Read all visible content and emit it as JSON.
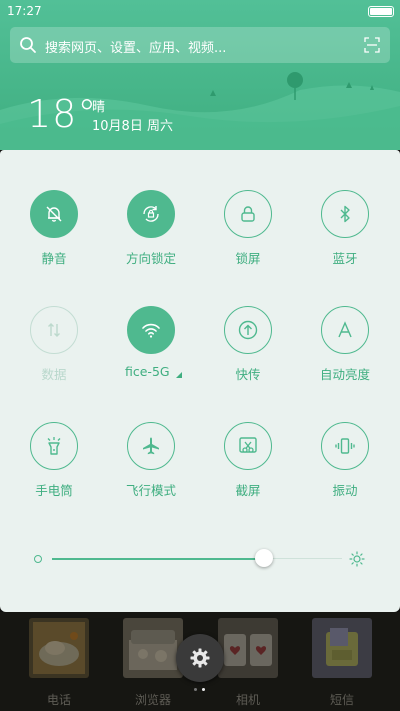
{
  "status_bar": {
    "time": "17:27"
  },
  "search": {
    "placeholder": "搜索网页、设置、应用、视频..."
  },
  "weather": {
    "temperature": "18°",
    "condition": "晴",
    "date": "10月8日 周六"
  },
  "tiles": [
    {
      "id": "mute",
      "label": "静音",
      "icon": "bell-off-icon",
      "state": "active"
    },
    {
      "id": "rotation-lock",
      "label": "方向锁定",
      "icon": "rotation-lock-icon",
      "state": "active"
    },
    {
      "id": "lock-screen",
      "label": "锁屏",
      "icon": "lock-icon",
      "state": "inactive"
    },
    {
      "id": "bluetooth",
      "label": "蓝牙",
      "icon": "bluetooth-icon",
      "state": "inactive"
    },
    {
      "id": "mobile-data",
      "label": "数据",
      "icon": "data-arrows-icon",
      "state": "disabled"
    },
    {
      "id": "wifi",
      "label": "fice-5G",
      "icon": "wifi-icon",
      "state": "active"
    },
    {
      "id": "quick-transfer",
      "label": "快传",
      "icon": "upload-icon",
      "state": "inactive"
    },
    {
      "id": "auto-brightness",
      "label": "自动亮度",
      "icon": "auto-brightness-icon",
      "state": "inactive"
    },
    {
      "id": "flashlight",
      "label": "手电筒",
      "icon": "flashlight-icon",
      "state": "inactive"
    },
    {
      "id": "airplane",
      "label": "飞行模式",
      "icon": "airplane-icon",
      "state": "inactive"
    },
    {
      "id": "screenshot",
      "label": "截屏",
      "icon": "screenshot-icon",
      "state": "inactive"
    },
    {
      "id": "vibrate",
      "label": "振动",
      "icon": "vibrate-icon",
      "state": "inactive"
    }
  ],
  "brightness": {
    "level": 0.73
  },
  "home_apps": [
    {
      "label": "电话"
    },
    {
      "label": "浏览器"
    },
    {
      "label": "相机"
    },
    {
      "label": "短信"
    }
  ],
  "colors": {
    "accent": "#4fb98f",
    "header": "#46b586",
    "panel": "#eaf2ef",
    "label": "#3fae80"
  }
}
